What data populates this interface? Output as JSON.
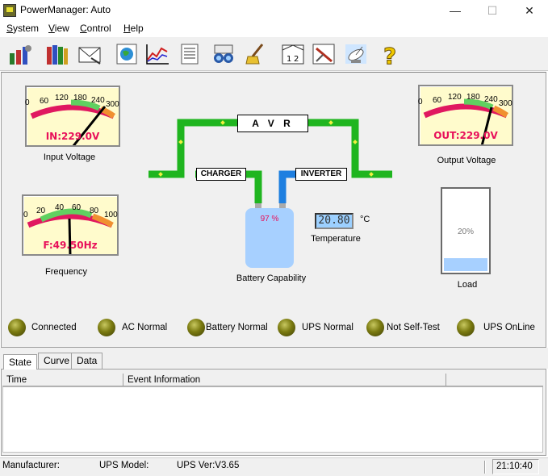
{
  "window": {
    "title": "PowerManager: Auto"
  },
  "menu": {
    "items": [
      {
        "accel": "S",
        "rest": "ystem"
      },
      {
        "accel": "V",
        "rest": "iew"
      },
      {
        "accel": "C",
        "rest": "ontrol"
      },
      {
        "accel": "H",
        "rest": "elp"
      }
    ]
  },
  "toolbar": {
    "icons": [
      "settings-icon",
      "books-icon",
      "envelope-icon",
      "globe-icon",
      "line-chart-icon",
      "list-icon",
      "binoculars-icon",
      "broom-icon",
      "calendar-icon",
      "tools-icon",
      "satellite-icon",
      "help-icon"
    ]
  },
  "meters": {
    "input": {
      "scale": [
        "0",
        "60",
        "120",
        "180",
        "240",
        "300"
      ],
      "readout": "IN:229.0V",
      "value": 229.0,
      "max": 300,
      "caption": "Input Voltage"
    },
    "output": {
      "scale": [
        "0",
        "60",
        "120",
        "180",
        "240",
        "300"
      ],
      "readout": "OUT:229.0V",
      "value": 229.0,
      "max": 300,
      "caption": "Output Voltage"
    },
    "frequency": {
      "scale": [
        "0",
        "20",
        "40",
        "60",
        "80",
        "100"
      ],
      "readout": "F:49.50Hz",
      "value": 49.5,
      "max": 100,
      "caption": "Frequency"
    }
  },
  "diagram": {
    "avr": "A V R",
    "charger": "CHARGER",
    "inverter": "INVERTER",
    "line_color": "#1fb51f",
    "inverter_color": "#1e7fe0",
    "battery_percent": "97 %",
    "battery_caption": "Battery Capability",
    "temperature": "20.80",
    "temp_unit": "°C",
    "temp_caption": "Temperature",
    "load_percent": "20%",
    "load_value": 0.2,
    "load_caption": "Load"
  },
  "status_leds": [
    {
      "label": "Connected"
    },
    {
      "label": "AC Normal"
    },
    {
      "label": "Battery Normal"
    },
    {
      "label": "UPS Normal"
    },
    {
      "label": "Not Self-Test"
    },
    {
      "label": "UPS OnLine"
    }
  ],
  "tabs": [
    "State",
    "Curve",
    "Data"
  ],
  "events": {
    "columns": [
      "Time",
      "Event Information"
    ],
    "rows": []
  },
  "statusbar": {
    "manufacturer": "Manufacturer:",
    "model": "UPS Model:",
    "version": "UPS Ver:V3.65",
    "time": "21:10:40"
  }
}
